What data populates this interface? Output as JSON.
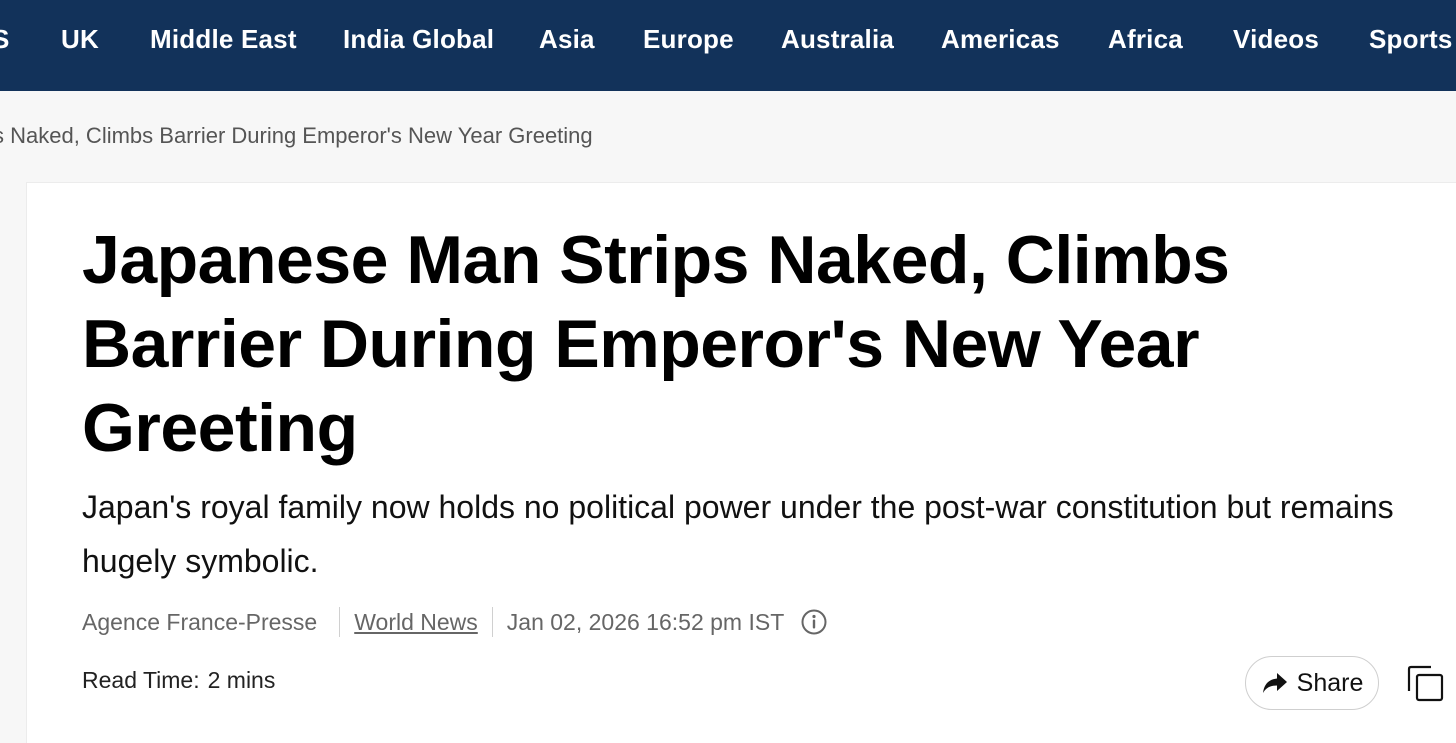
{
  "nav": {
    "items": [
      "S",
      "UK",
      "Middle East",
      "India Global",
      "Asia",
      "Europe",
      "Australia",
      "Americas",
      "Africa",
      "Videos",
      "Sports"
    ]
  },
  "breadcrumb": "s Naked, Climbs Barrier During Emperor's New Year Greeting",
  "article": {
    "headline": "Japanese Man Strips Naked, Climbs Barrier During Emperor's New Year Greeting",
    "subhead": "Japan's royal family now holds no political power under the post-war constitution but remains hugely symbolic.",
    "source": "Agence France-Presse",
    "category": "World News",
    "timestamp": "Jan 02, 2026 16:52 pm IST",
    "read_time_label": "Read Time:",
    "read_time_value": "2 mins",
    "share_label": "Share"
  },
  "colors": {
    "nav_bg": "#12325a",
    "page_bg": "#f7f7f7",
    "card_bg": "#ffffff"
  },
  "icons": [
    "info-icon",
    "share-arrow-icon",
    "copy-icon"
  ]
}
